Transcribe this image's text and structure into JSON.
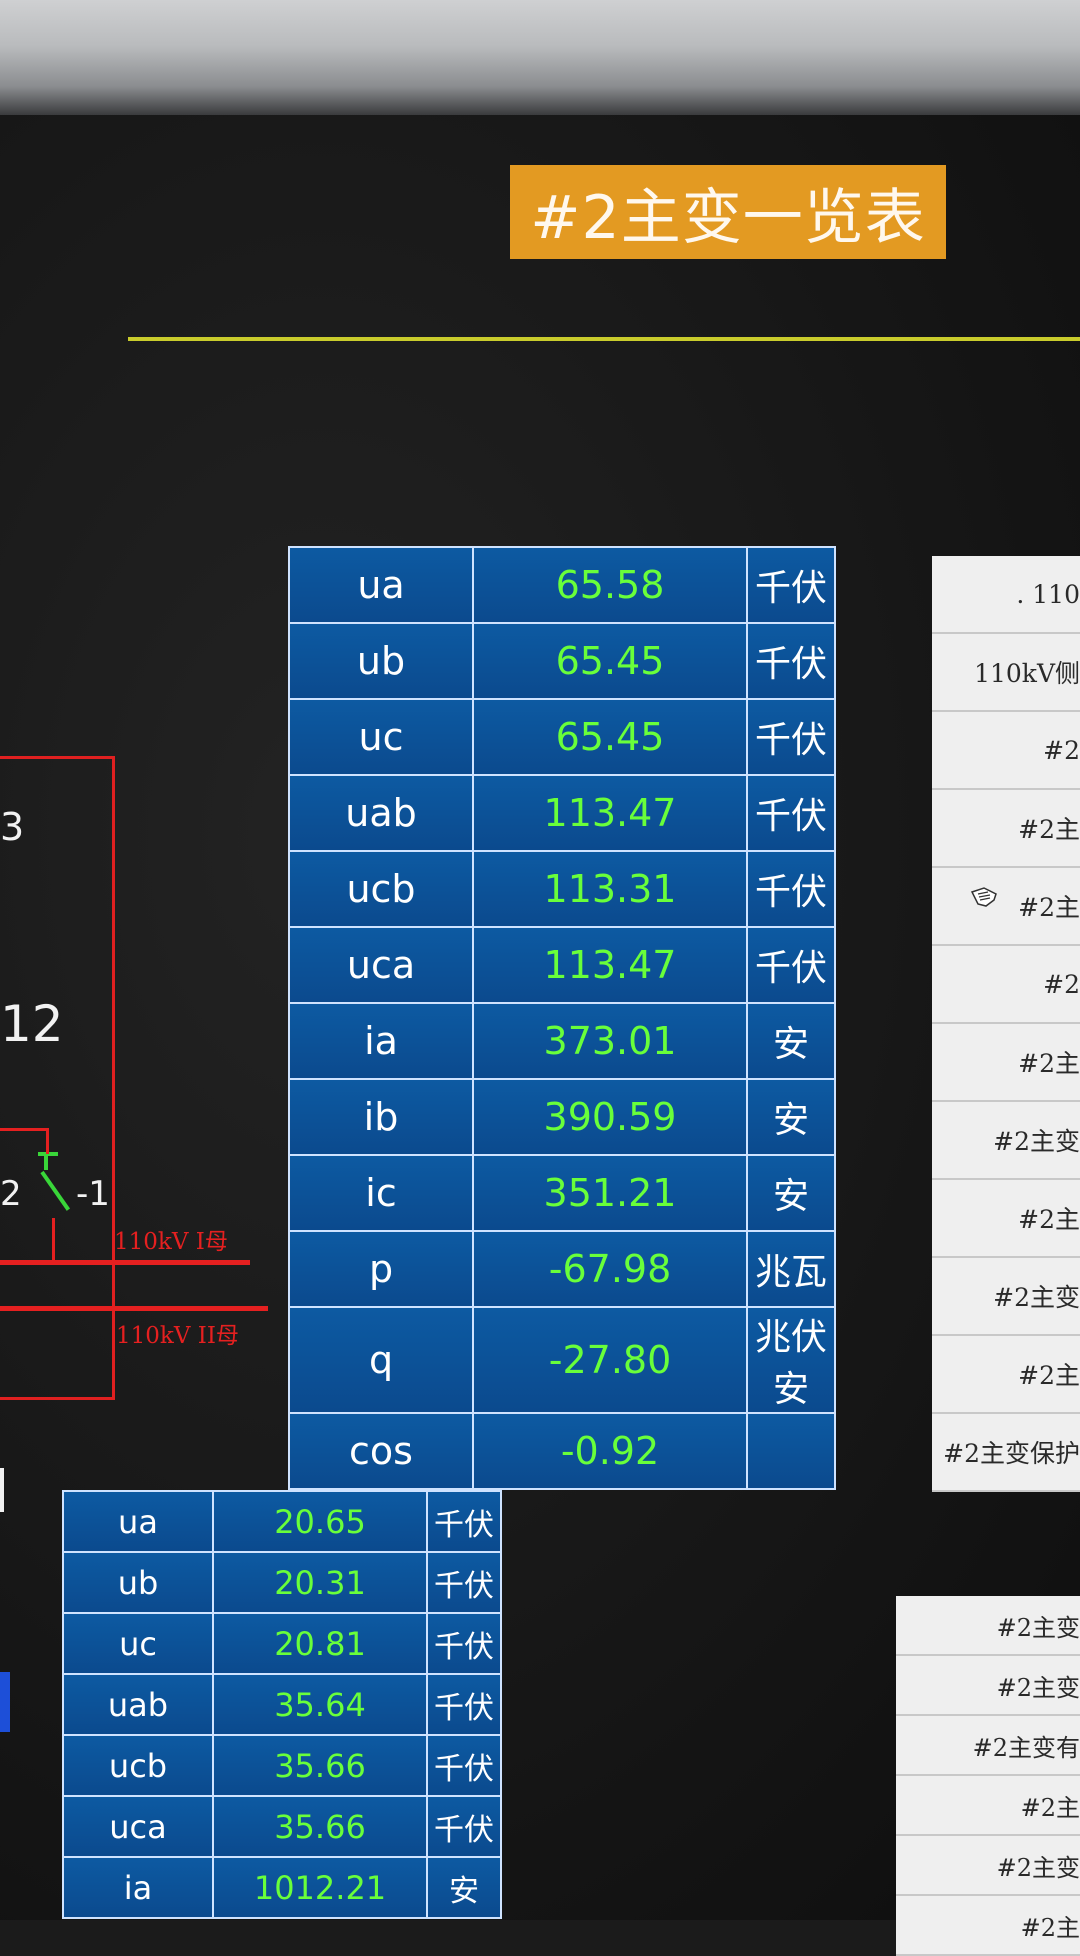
{
  "title": "#2主变一览表",
  "diagram": {
    "label_3": "3",
    "label_12": "12",
    "label_2": "2",
    "label_m1": "-1",
    "bus1_label": "110kV I母",
    "bus2_label": "110kV II母"
  },
  "table_110kv": {
    "rows": [
      {
        "name": "ua",
        "value": "65.58",
        "unit": "千伏"
      },
      {
        "name": "ub",
        "value": "65.45",
        "unit": "千伏"
      },
      {
        "name": "uc",
        "value": "65.45",
        "unit": "千伏"
      },
      {
        "name": "uab",
        "value": "113.47",
        "unit": "千伏"
      },
      {
        "name": "ucb",
        "value": "113.31",
        "unit": "千伏"
      },
      {
        "name": "uca",
        "value": "113.47",
        "unit": "千伏"
      },
      {
        "name": "ia",
        "value": "373.01",
        "unit": "安"
      },
      {
        "name": "ib",
        "value": "390.59",
        "unit": "安"
      },
      {
        "name": "ic",
        "value": "351.21",
        "unit": "安"
      },
      {
        "name": "p",
        "value": "-67.98",
        "unit": "兆瓦"
      },
      {
        "name": "q",
        "value": "-27.80",
        "unit": "兆伏安"
      },
      {
        "name": "cos",
        "value": "-0.92",
        "unit": ""
      }
    ]
  },
  "table_low": {
    "rows": [
      {
        "name": "ua",
        "value": "20.65",
        "unit": "千伏"
      },
      {
        "name": "ub",
        "value": "20.31",
        "unit": "千伏"
      },
      {
        "name": "uc",
        "value": "20.81",
        "unit": "千伏"
      },
      {
        "name": "uab",
        "value": "35.64",
        "unit": "千伏"
      },
      {
        "name": "ucb",
        "value": "35.66",
        "unit": "千伏"
      },
      {
        "name": "uca",
        "value": "35.66",
        "unit": "千伏"
      },
      {
        "name": "ia",
        "value": "1012.21",
        "unit": "安"
      }
    ]
  },
  "side_panel_top": [
    ". 110",
    "110kV侧",
    "#2",
    "#2主",
    "#2主",
    "#2",
    "#2主",
    "#2主变",
    "#2主",
    "#2主变",
    "#2主",
    "#2主变保护"
  ],
  "side_panel_bottom": [
    "#2主变",
    "#2主变",
    "#2主变有",
    "#2主",
    "#2主变",
    "#2主"
  ],
  "colors": {
    "title_bg": "#e39a22",
    "value_green": "#69ff3a",
    "cell_blue": "#0d5aa2",
    "bus_red": "#e52020",
    "divider_yellow": "#c9cc2c"
  },
  "icons": {
    "cursor": "hand-pointer-icon"
  }
}
